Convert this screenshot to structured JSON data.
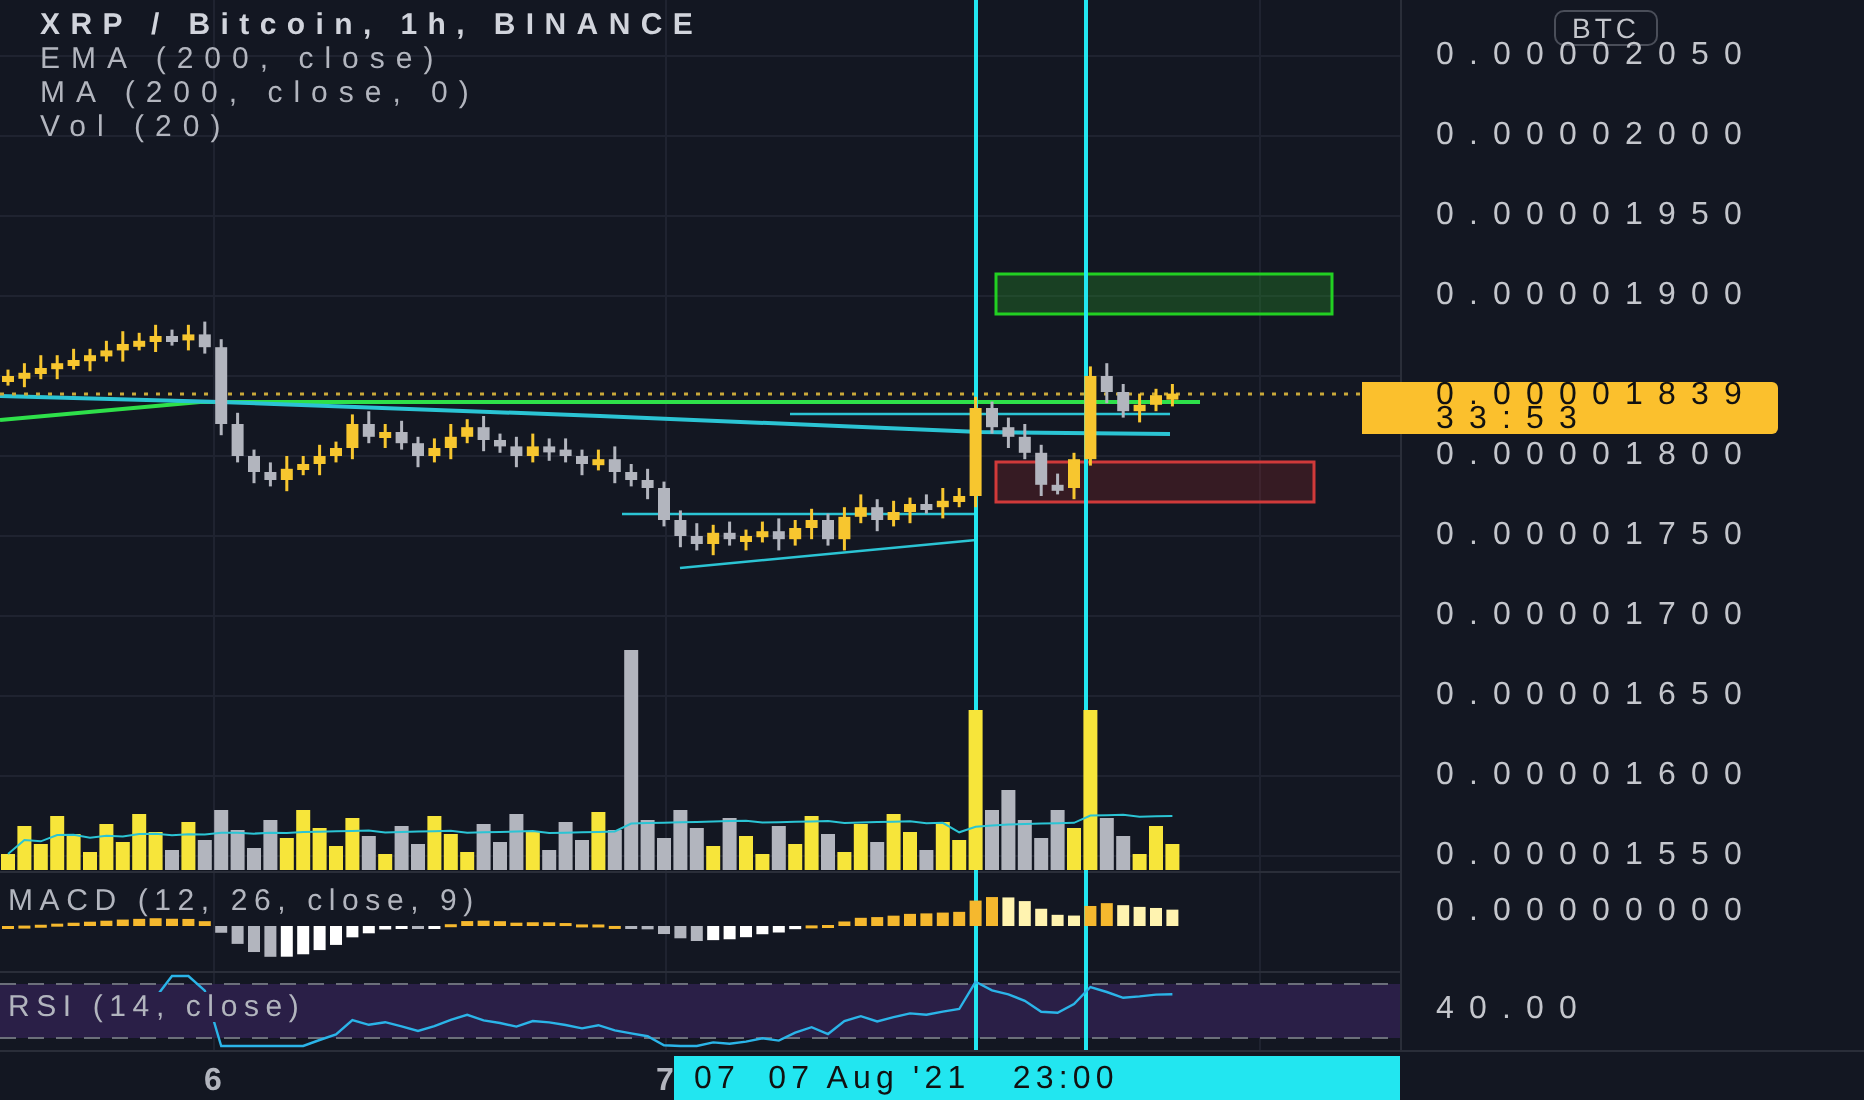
{
  "header": {
    "title": "XRP / Bitcoin, 1h, BINANCE",
    "indicators": [
      "EMA (200, close)",
      "MA (200, close, 0)",
      "Vol (20)"
    ]
  },
  "currency": "BTC",
  "price_axis": {
    "labels": [
      "0.00002050",
      "0.00002000",
      "0.00001950",
      "0.00001900",
      "0.00001800",
      "0.00001750",
      "0.00001700",
      "0.00001650",
      "0.00001600",
      "0.00001550"
    ]
  },
  "last_price": {
    "value": "0.00001839",
    "countdown": "33:53"
  },
  "macd": {
    "label": "MACD (12, 26, close, 9)",
    "axis_label": "0.00000000"
  },
  "rsi": {
    "label": "RSI (14, close)",
    "axis_label": "40.00"
  },
  "time_axis": {
    "labels": [
      "6",
      "7"
    ],
    "crosshair_label": "07  07 Aug '21   23:00"
  }
}
